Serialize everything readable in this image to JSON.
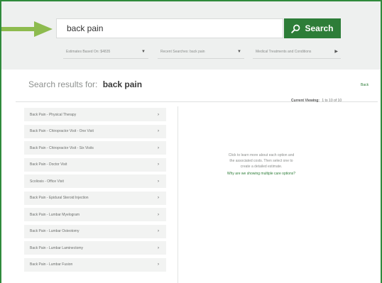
{
  "search": {
    "value": "back pain",
    "button_label": "Search"
  },
  "filters": {
    "estimate_label": "Estimates Based On: $4835",
    "recent_label": "Recent Searches: back pain",
    "medical_label": "Medical Treatments and Conditions"
  },
  "results": {
    "header_prefix": "Search results for:",
    "query": "back pain",
    "back_label": "Back",
    "current_viewing_label": "Current Viewing:",
    "current_viewing_value": "1 to 10 of 10",
    "items": [
      {
        "label": "Back Pain - Physical Therapy"
      },
      {
        "label": "Back Pain - Chiropractor Visit - One Visit"
      },
      {
        "label": "Back Pain - Chiropractor Visit - Six Visits"
      },
      {
        "label": "Back Pain - Doctor Visit"
      },
      {
        "label": "Scoliosis - Office Visit"
      },
      {
        "label": "Back Pain - Epidural Steroid Injection"
      },
      {
        "label": "Back Pain - Lumbar Myelogram"
      },
      {
        "label": "Back Pain - Lumbar Osteotomy"
      },
      {
        "label": "Back Pain - Lumbar Laminectomy"
      },
      {
        "label": "Back Pain - Lumbar Fusion"
      }
    ]
  },
  "info": {
    "line1": "Click to learn more about each option and",
    "line2": "the associated costs. Then select one to",
    "line3": "create a detailed estimate.",
    "link": "Why are we showing multiple care options?"
  },
  "icons": {
    "search": "search-icon",
    "arrow": "arrow-right-icon",
    "caret": "caret-down-icon",
    "chevron": "chevron-right-icon"
  },
  "colors": {
    "brand_green": "#2d7d38",
    "arrow_green": "#8dbb4e",
    "frame_green": "#2f8a3c"
  }
}
